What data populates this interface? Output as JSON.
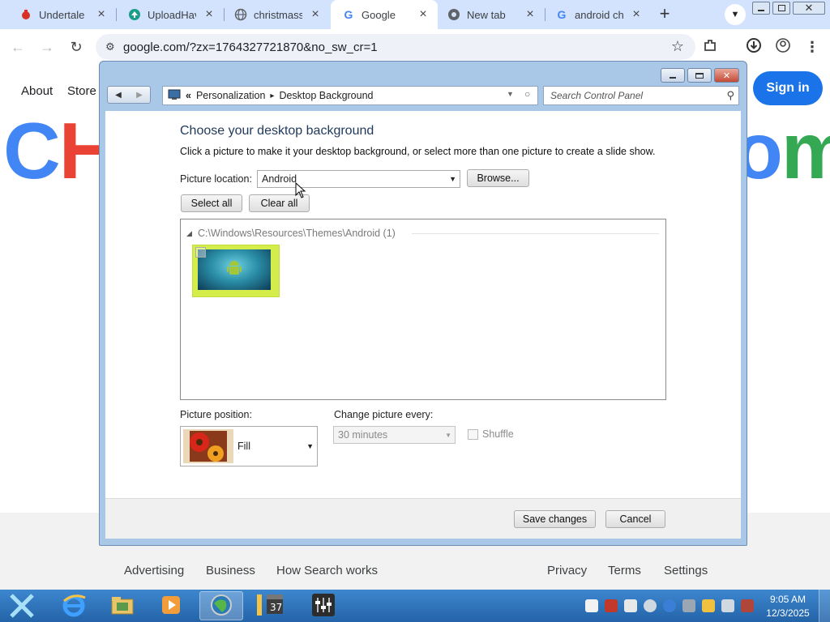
{
  "browser": {
    "tabs": [
      {
        "title": "Undertale F",
        "icon": "red-app-icon",
        "active": false
      },
      {
        "title": "UploadHave",
        "icon": "upload-icon",
        "active": false
      },
      {
        "title": "christmassh",
        "icon": "globe-icon",
        "active": false
      },
      {
        "title": "Google",
        "icon": "google-icon",
        "active": true
      },
      {
        "title": "New tab",
        "icon": "chrome-icon",
        "active": false
      },
      {
        "title": "android che",
        "icon": "google-icon",
        "active": false
      }
    ],
    "new_tab_symbol": "+",
    "close_symbol": "×",
    "url": "google.com/?zx=1764327721870&no_sw_cr=1"
  },
  "google": {
    "about": "About",
    "store": "Store",
    "sign_in": "Sign in",
    "logo_left": "CH",
    "logo_right": "om",
    "footer": {
      "advertising": "Advertising",
      "business": "Business",
      "how_search_works": "How Search works",
      "privacy": "Privacy",
      "terms": "Terms",
      "settings": "Settings"
    }
  },
  "dialog": {
    "breadcrumb": {
      "chevrons": "«",
      "parent": "Personalization",
      "arrow": "▸",
      "current": "Desktop Background"
    },
    "search_placeholder": "Search Control Panel",
    "heading": "Choose your desktop background",
    "description": "Click a picture to make it your desktop background, or select more than one picture to create a slide show.",
    "picture_location_label": "Picture location:",
    "picture_location_value": "Android",
    "browse_label": "Browse...",
    "select_all_label": "Select all",
    "clear_all_label": "Clear all",
    "group_header": "C:\\Windows\\Resources\\Themes\\Android (1)",
    "picture_position_label": "Picture position:",
    "picture_position_value": "Fill",
    "change_picture_label": "Change picture every:",
    "change_picture_value": "30 minutes",
    "shuffle_label": "Shuffle",
    "save_label": "Save changes",
    "cancel_label": "Cancel"
  },
  "taskbar": {
    "time": "9:05 AM",
    "date": "12/3/2025"
  }
}
